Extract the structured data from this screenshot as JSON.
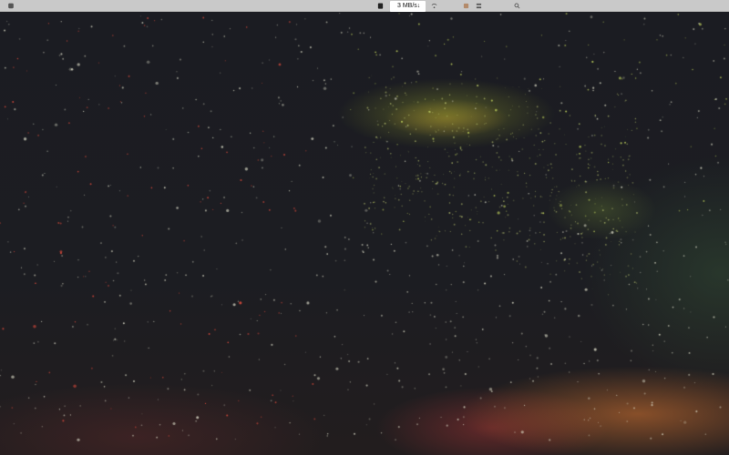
{
  "menubar": {
    "app_name": "",
    "menus": [
      "",
      "",
      "",
      "",
      "",
      "",
      "",
      "",
      ""
    ],
    "status": {
      "network_speed": "3 MB/s↓",
      "items": [
        "",
        "",
        "",
        "",
        "",
        "",
        "",
        ""
      ]
    }
  },
  "icons": {
    "apple": "apple-icon",
    "wifi": "wifi-icon",
    "battery": "battery-icon",
    "search": "search-icon",
    "control_center": "control-center-icon"
  },
  "colors": {
    "menubar_bg": "#c9c9c9",
    "sky": "#1b1c22",
    "star_red": "#d94a3c",
    "star_green": "#b8c95a",
    "glow_orange": "#dc7832"
  }
}
